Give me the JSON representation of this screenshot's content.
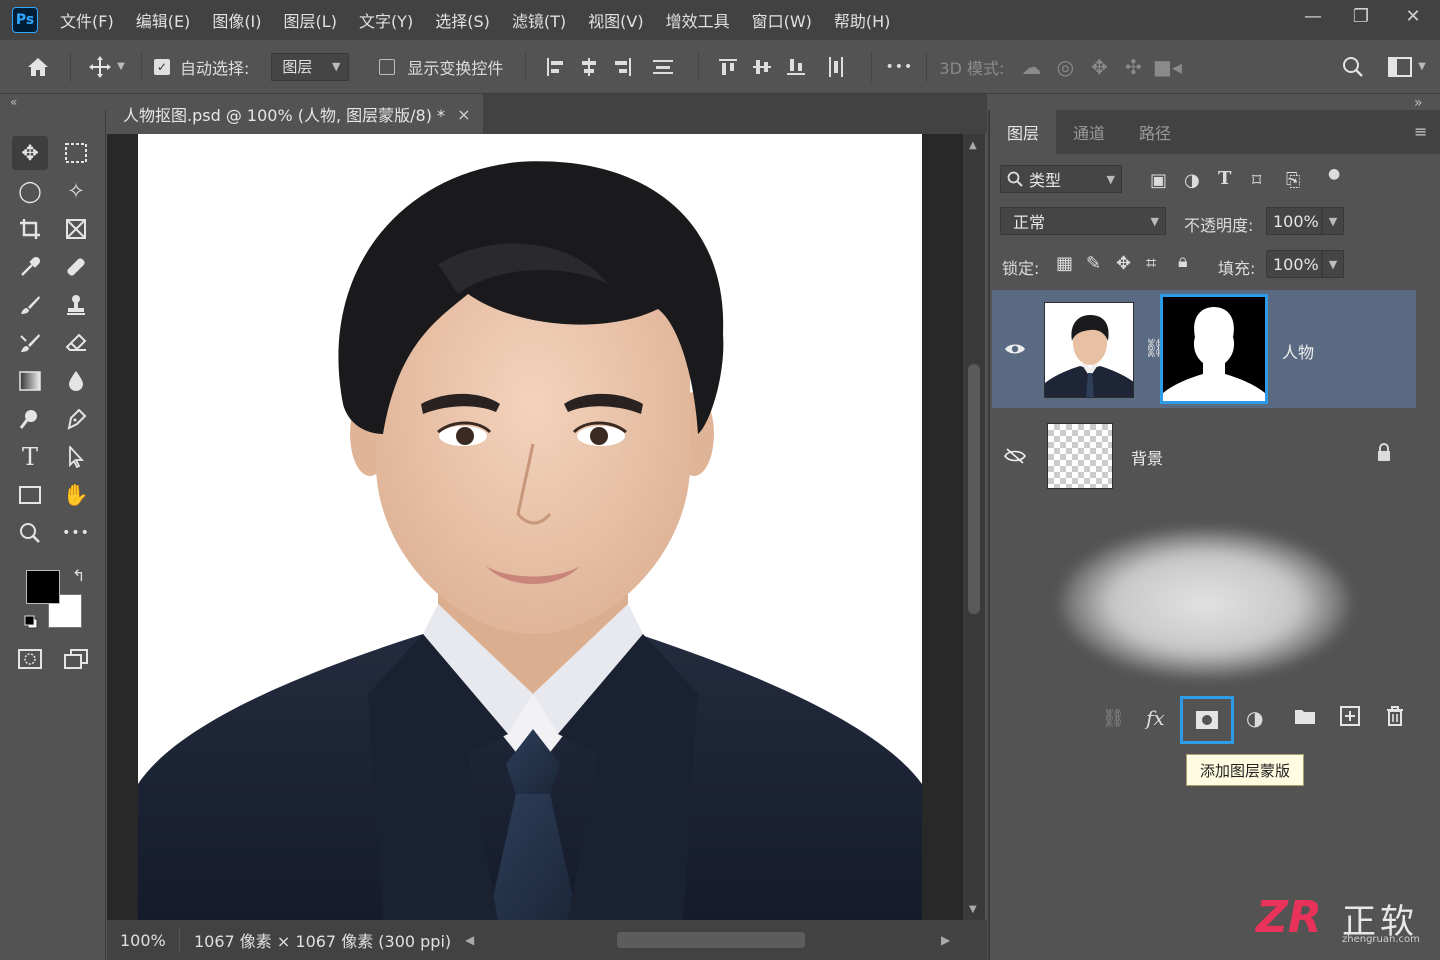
{
  "app": {
    "logo": "Ps"
  },
  "menu": [
    "文件(F)",
    "编辑(E)",
    "图像(I)",
    "图层(L)",
    "文字(Y)",
    "选择(S)",
    "滤镜(T)",
    "视图(V)",
    "增效工具",
    "窗口(W)",
    "帮助(H)"
  ],
  "window_controls": {
    "minimize": "—",
    "restore": "❐",
    "close": "✕"
  },
  "options": {
    "auto_select_label": "自动选择:",
    "auto_select_checked": true,
    "auto_select_target": "图层",
    "show_transform_label": "显示变换控件",
    "show_transform_checked": false,
    "more": "•••",
    "mode_3d_label": "3D 模式:"
  },
  "document": {
    "tab_title": "人物抠图.psd @ 100% (人物, 图层蒙版/8) *",
    "close": "×",
    "zoom": "100%",
    "info": "1067 像素 × 1067 像素 (300 ppi)"
  },
  "panel": {
    "tabs": [
      "图层",
      "通道",
      "路径"
    ],
    "active_tab": 0,
    "filter_label": "类型",
    "blend_mode": "正常",
    "opacity_label": "不透明度:",
    "opacity_value": "100%",
    "lock_label": "锁定:",
    "fill_label": "填充:",
    "fill_value": "100%",
    "layers": [
      {
        "name": "人物",
        "visible": true,
        "selected": true,
        "has_mask": true,
        "locked": false
      },
      {
        "name": "背景",
        "visible": false,
        "selected": false,
        "has_mask": false,
        "locked": true
      }
    ],
    "tooltip": "添加图层蒙版",
    "bottom_icons": [
      "link-icon",
      "fx-icon",
      "add-mask-icon",
      "adjustment-icon",
      "folder-icon",
      "new-layer-icon",
      "trash-icon"
    ],
    "fx_label": "fx"
  },
  "watermark": {
    "logo": "ZR",
    "title": "正软",
    "url": "zhengruan.com"
  },
  "colors": {
    "accent": "#31a8ff",
    "selected_layer": "#5a6a83",
    "brand_pink": "#e8325a"
  }
}
